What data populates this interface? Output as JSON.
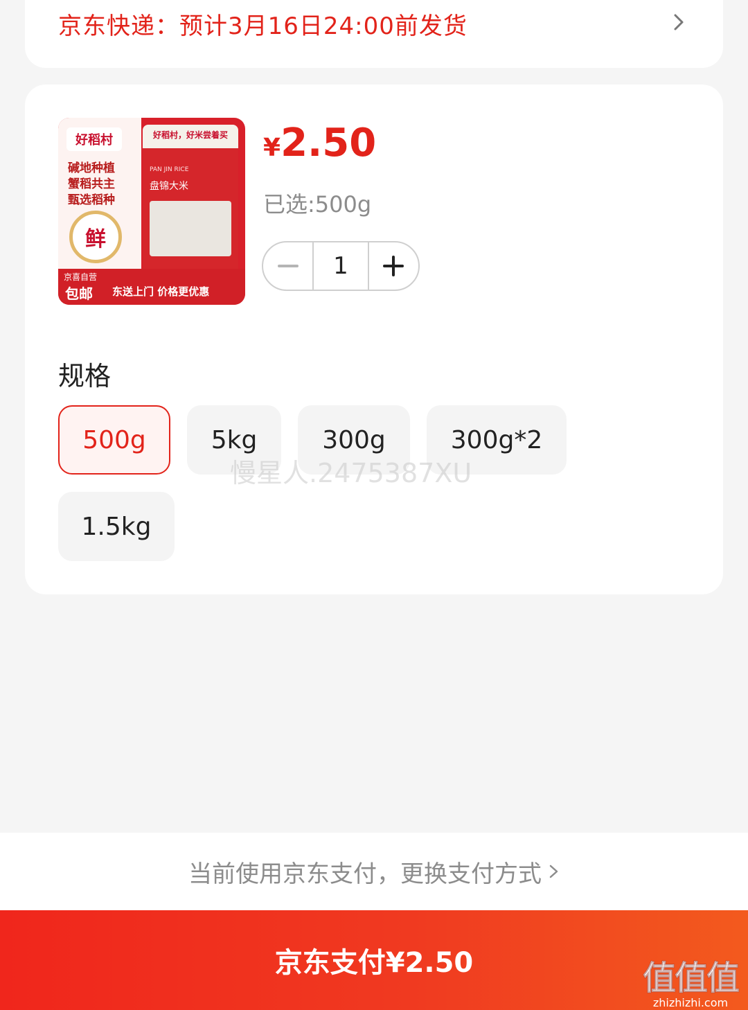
{
  "delivery": {
    "text": "京东快递：预计3月16日24:00前发货"
  },
  "product": {
    "image": {
      "brand": "好稻村",
      "slogan": "碱地种植 蟹稻共主 甄选稻种",
      "seal": "鲜",
      "bag_top": "好稻村，好米尝着买",
      "bag_sub": "PAN JIN RICE",
      "bag_title": "盘锦大米",
      "badge_jd": "京喜自营",
      "badge_free": "包邮",
      "badge_tag": "东送上门 价格更优惠"
    },
    "price_currency": "¥",
    "price_amount": "2.50",
    "selected_label": "已选:500g",
    "quantity": "1"
  },
  "spec": {
    "title": "规格",
    "options": [
      "500g",
      "5kg",
      "300g",
      "300g*2",
      "1.5kg"
    ],
    "selected": "500g"
  },
  "watermark": "慢星人.2475387XU",
  "footer": {
    "pay_switch": "当前使用京东支付，更换支付方式",
    "pay_button": "京东支付¥2.50"
  },
  "site_logo": {
    "mark": "值值值",
    "url": "zhizhizhi.com"
  },
  "colors": {
    "accent": "#e2231a",
    "background": "#f5f5f5"
  }
}
